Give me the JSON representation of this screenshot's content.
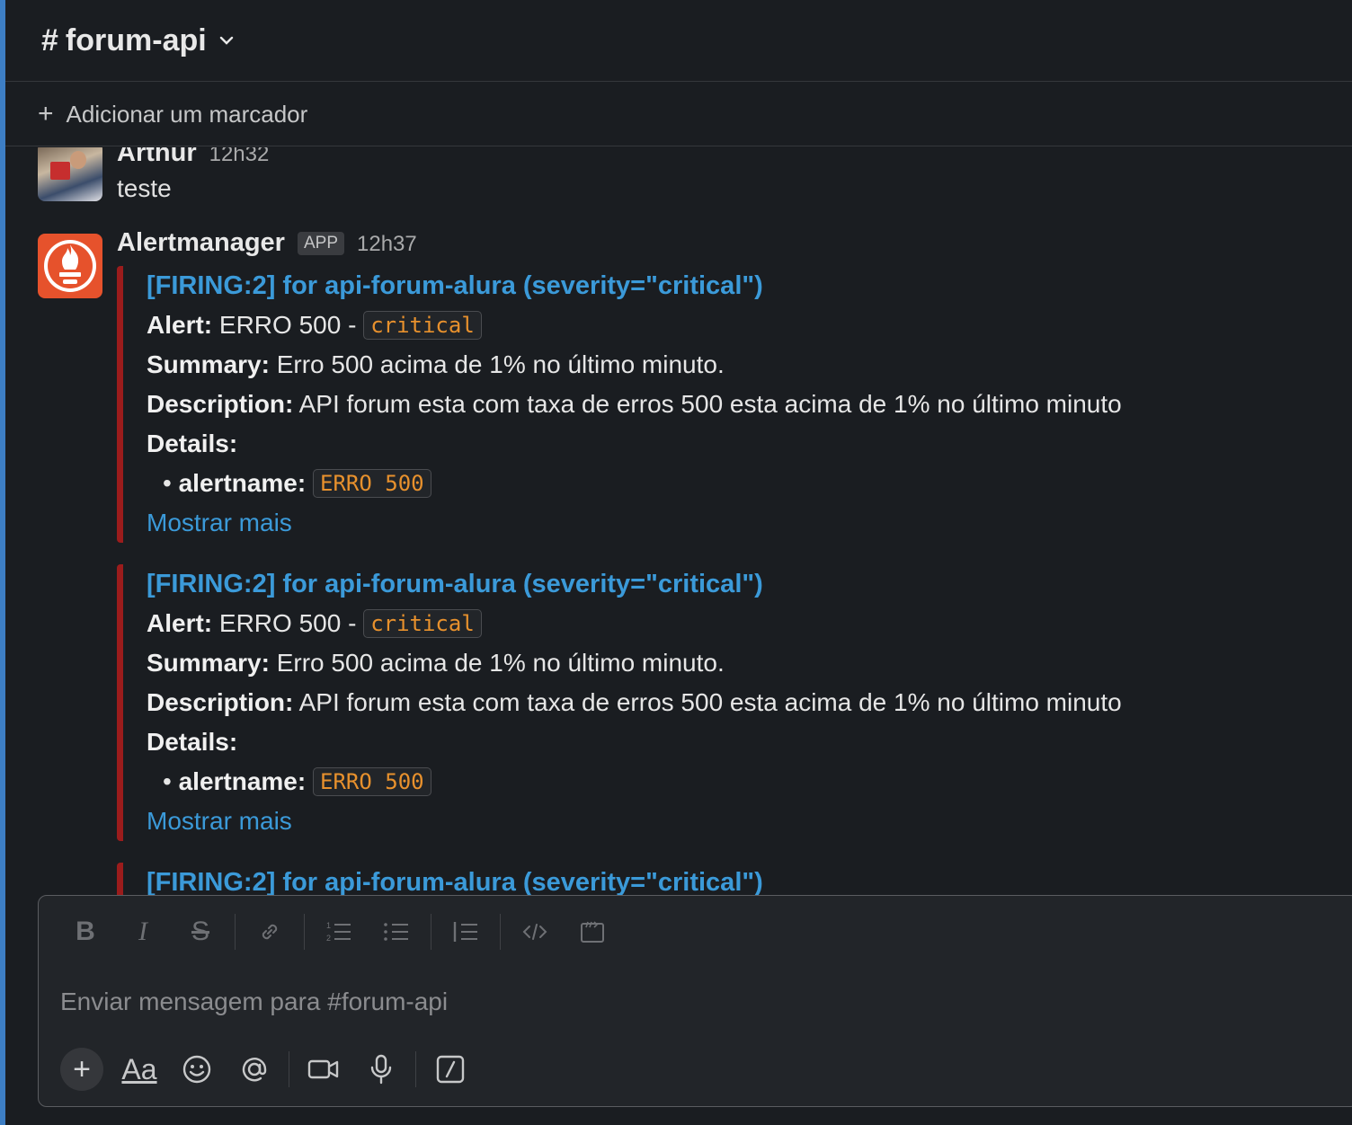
{
  "header": {
    "hash": "#",
    "channel": "forum-api",
    "chevron": "⌄"
  },
  "bookmarks": {
    "plus": "+",
    "label": "Adicionar um marcador"
  },
  "messages": [
    {
      "sender": "Arthur",
      "time": "12h32",
      "text": "teste"
    },
    {
      "sender": "Alertmanager",
      "badge": "APP",
      "time": "12h37"
    }
  ],
  "alerts": [
    {
      "title": "[FIRING:2]  for api-forum-alura (severity=\"critical\")",
      "alert_label": "Alert:",
      "alert_value": "ERRO 500 -",
      "alert_code": "critical",
      "summary_label": "Summary:",
      "summary_value": "Erro 500 acima de 1% no último minuto.",
      "description_label": "Description:",
      "description_value": "API forum esta com taxa de erros 500 esta acima de 1% no último minuto",
      "details_label": "Details:",
      "bullet": "•",
      "detail_key": "alertname:",
      "detail_code": "ERRO 500",
      "more": "Mostrar mais"
    },
    {
      "title": "[FIRING:2]  for api-forum-alura (severity=\"critical\")",
      "alert_label": "Alert:",
      "alert_value": "ERRO 500 -",
      "alert_code": "critical",
      "summary_label": "Summary:",
      "summary_value": "Erro 500 acima de 1% no último minuto.",
      "description_label": "Description:",
      "description_value": "API forum esta com taxa de erros 500 esta acima de 1% no último minuto",
      "details_label": "Details:",
      "bullet": "•",
      "detail_key": "alertname:",
      "detail_code": "ERRO 500",
      "more": "Mostrar mais"
    },
    {
      "title": "[FIRING:2]  for api-forum-alura (severity=\"critical\")"
    }
  ],
  "composer": {
    "placeholder": "Enviar mensagem para #forum-api",
    "format_buttons": [
      "bold-icon",
      "italic-icon",
      "strikethrough-icon",
      "link-icon",
      "ordered-list-icon",
      "bulleted-list-icon",
      "blockquote-icon",
      "code-icon",
      "code-block-icon"
    ],
    "bottom_buttons": [
      "plus-icon",
      "formatting-icon",
      "emoji-icon",
      "mention-icon",
      "video-icon",
      "microphone-icon",
      "shortcuts-icon"
    ],
    "aa": "Aa"
  },
  "colors": {
    "accent": "#3d7ec4",
    "link": "#3b9ad9",
    "alert_bar": "#9b1c1c",
    "code": "#e8912d",
    "prometheus": "#e6522c"
  }
}
